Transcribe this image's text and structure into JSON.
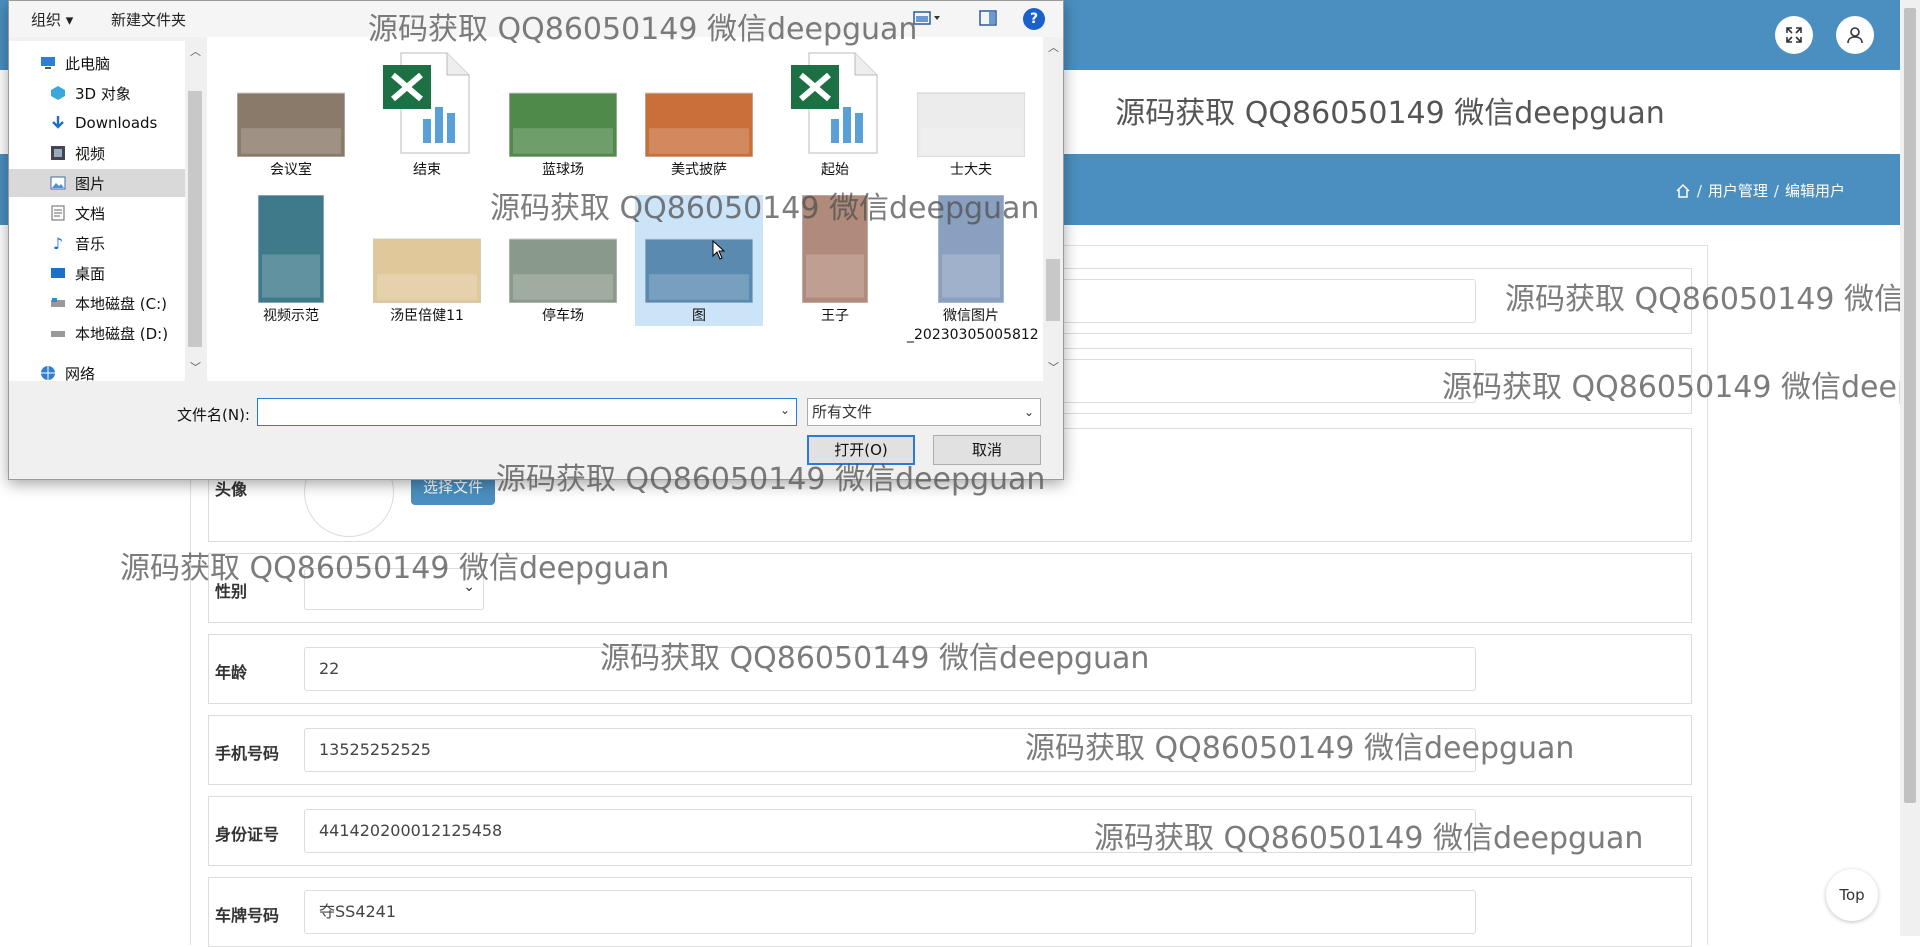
{
  "header": {
    "page_title": "源码获取 QQ86050149 微信deepguan",
    "breadcrumb": [
      "用户管理",
      "编辑用户"
    ],
    "breadcrumb_sep": "/",
    "top_button": "Top"
  },
  "form": {
    "fields": [
      {
        "label": "",
        "value": ""
      },
      {
        "label": "",
        "value": ""
      },
      {
        "label": "头像",
        "button": "选择文件"
      },
      {
        "label": "性别",
        "value": ""
      },
      {
        "label": "年龄",
        "value": "22"
      },
      {
        "label": "手机号码",
        "value": "13525252525"
      },
      {
        "label": "身份证号",
        "value": "441420200012125458"
      },
      {
        "label": "车牌号码",
        "value": "夺SS4241"
      }
    ]
  },
  "dialog": {
    "toolbar": {
      "organize": "组织 ▾",
      "new_folder": "新建文件夹",
      "help": "?"
    },
    "nav": [
      {
        "label": "此电脑",
        "icon": "computer-icon"
      },
      {
        "label": "3D 对象",
        "icon": "cube-icon"
      },
      {
        "label": "Downloads",
        "icon": "download-icon"
      },
      {
        "label": "视频",
        "icon": "video-icon"
      },
      {
        "label": "图片",
        "icon": "picture-icon"
      },
      {
        "label": "文档",
        "icon": "document-icon"
      },
      {
        "label": "音乐",
        "icon": "music-icon"
      },
      {
        "label": "桌面",
        "icon": "desktop-icon"
      },
      {
        "label": "本地磁盘 (C:)",
        "icon": "drive-icon"
      },
      {
        "label": "本地磁盘 (D:)",
        "icon": "drive-icon"
      },
      {
        "label": "网络",
        "icon": "network-icon"
      }
    ],
    "files": [
      {
        "name": "会议室",
        "kind": "photo",
        "color": "#8a7a6a"
      },
      {
        "name": "结束",
        "kind": "excel",
        "color": "#1d7044"
      },
      {
        "name": "蓝球场",
        "kind": "photo",
        "color": "#4f8a4a"
      },
      {
        "name": "美式披萨",
        "kind": "photo",
        "color": "#c9703a"
      },
      {
        "name": "起始",
        "kind": "excel",
        "color": "#1d7044"
      },
      {
        "name": "士大夫",
        "kind": "photo",
        "color": "#ececec"
      },
      {
        "name": "视频示范",
        "kind": "photo",
        "color": "#3e7a8a"
      },
      {
        "name": "汤臣倍健11",
        "kind": "photo",
        "color": "#e0c89a"
      },
      {
        "name": "停车场",
        "kind": "photo",
        "color": "#8a9a8a"
      },
      {
        "name": "图",
        "kind": "photo",
        "color": "#5a8ab0"
      },
      {
        "name": "王子",
        "kind": "photo",
        "color": "#b08a7a"
      },
      {
        "name": "微信图片_20230305005812",
        "kind": "photo",
        "color": "#8aa0c0"
      }
    ],
    "filename_label": "文件名(N):",
    "filename_value": "",
    "filter": "所有文件",
    "open_button": "打开(O)",
    "cancel_button": "取消"
  },
  "watermark": "源码获取 QQ86050149 微信deepguan",
  "colors": {
    "accent": "#4a8fbf",
    "dialog_focus": "#2a7ad8",
    "selected_file": "#cce4f7"
  }
}
